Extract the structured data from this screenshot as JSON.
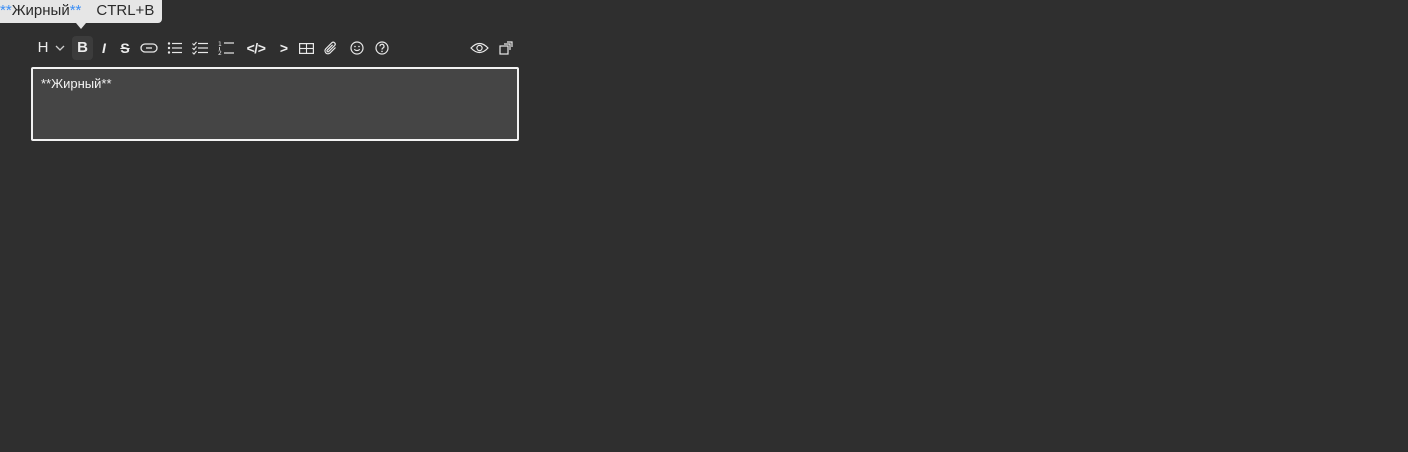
{
  "tooltip": {
    "markup_open": "**",
    "label": "Жирный",
    "markup_close": "**",
    "shortcut": "CTRL+B"
  },
  "toolbar": {
    "heading_label": "H",
    "bold_label": "B",
    "italic_label": "I",
    "strike_label": "S",
    "code_label": "</>",
    "quote_label": ">",
    "icons": [
      "heading-icon",
      "chevron-down-icon",
      "bold-icon",
      "italic-icon",
      "strikethrough-icon",
      "link-icon",
      "bulleted-list-icon",
      "task-list-icon",
      "numbered-list-icon",
      "code-icon",
      "quote-icon",
      "table-icon",
      "attachment-icon",
      "emoji-icon",
      "help-icon",
      "preview-eye-icon",
      "fullscreen-icon"
    ],
    "active": "bold"
  },
  "editor": {
    "value": "**Жирный**"
  },
  "colors": {
    "background": "#2f2f2f",
    "editor_bg": "#454545",
    "editor_border": "#f2f2f2",
    "tooltip_bg": "#e6e6e6",
    "markup_accent": "#3d8ff5"
  }
}
